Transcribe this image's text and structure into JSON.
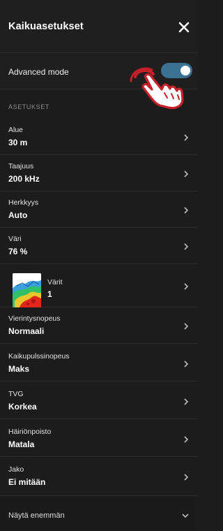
{
  "header": {
    "title": "Kaikuasetukset",
    "close_icon": "close-icon"
  },
  "advanced": {
    "label": "Advanced mode",
    "enabled": true,
    "accent": "#3b7191"
  },
  "section": {
    "label": "ASETUKSET"
  },
  "settings": [
    {
      "label": "Alue",
      "value": "30 m"
    },
    {
      "label": "Taajuus",
      "value": "200 kHz"
    },
    {
      "label": "Herkkyys",
      "value": "Auto"
    },
    {
      "label": "Väri",
      "value": "76 %"
    },
    {
      "label": "Värit",
      "value": "1",
      "icon": "echo-palette-thumbnail"
    },
    {
      "label": "Vierintysnopeus",
      "value": "Normaali"
    },
    {
      "label": "Kaikupulssinopeus",
      "value": "Maks"
    },
    {
      "label": "TVG",
      "value": "Korkea"
    },
    {
      "label": "Häiriönpoisto",
      "value": "Matala"
    },
    {
      "label": "Jako",
      "value": "Ei mitään"
    }
  ],
  "footer": {
    "show_more_label": "Näytä enemmän",
    "icon": "chevron-down-icon"
  },
  "overlay": {
    "icon": "tap-hand-icon",
    "color": "#c8202a"
  }
}
